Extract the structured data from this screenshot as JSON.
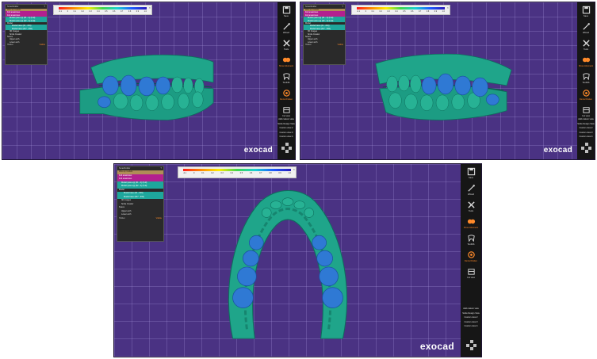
{
  "brand": {
    "logo": "exocad"
  },
  "toolbar": {
    "items": [
      {
        "icon": "save-icon",
        "label": "Save"
      },
      {
        "icon": "wizard-icon",
        "label": "Wizard"
      },
      {
        "icon": "tools-icon",
        "label": "Tools"
      },
      {
        "icon": "smart-abutment-icon",
        "label": "Show Abutment"
      },
      {
        "icon": "toothlib-icon",
        "label": "Toothlib"
      },
      {
        "icon": "tooth-scheme-icon",
        "label": "Dental Flatten"
      },
      {
        "icon": "cut-view-icon",
        "label": "Cut view"
      }
    ],
    "views": [
      "Add custom view",
      "Smile Design View",
      "Custom view 2",
      "Custom view 3",
      "Custom view 4"
    ]
  },
  "tree": {
    "header": "SmartFolder",
    "rows": [
      "Wax-up models",
      "Full anatomies",
      "Full anatomies",
      "Model (wax-up) (#1 - 4) (Full)",
      "Model (wax-up) (#2 - 4) (Full)",
      "Model",
      "Model base (#1 - #16)",
      "Model base (#17 - #32)",
      "3D Images",
      "Smile Creator",
      "Scans",
      "Upper arch",
      "Lower arch",
      "Hidden"
    ],
    "footer": "Visible"
  },
  "scale": {
    "ticks": [
      "-0.1",
      "0",
      "0.1",
      "0.2",
      "0.3",
      "0.4",
      "0.5",
      "0.6",
      "0.7",
      "0.8",
      "0.9",
      "1.0"
    ]
  },
  "colors": {
    "viewport": "#4a3283",
    "gingiva": "#1fa58a",
    "teeth": "#2f79d4",
    "accent": "#ff8a2a"
  }
}
